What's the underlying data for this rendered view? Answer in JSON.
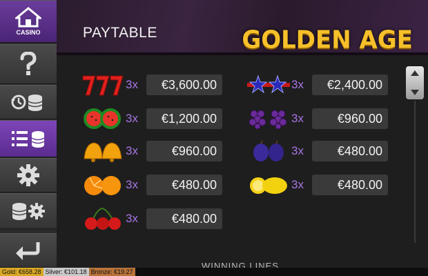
{
  "sidebar": {
    "casino_label": "CASINO",
    "items": [
      {
        "name": "casino",
        "icon": "home-icon"
      },
      {
        "name": "help",
        "icon": "question-icon"
      },
      {
        "name": "history",
        "icon": "history-icon"
      },
      {
        "name": "paytable",
        "icon": "paytable-icon",
        "active": true
      },
      {
        "name": "settings",
        "icon": "gear-icon"
      },
      {
        "name": "bet-settings",
        "icon": "coins-gear-icon"
      },
      {
        "name": "back",
        "icon": "back-arrow-icon"
      }
    ]
  },
  "header": {
    "title": "PAYTABLE",
    "logo_text": "GOLDEN AGE"
  },
  "paytable": {
    "left": [
      {
        "symbol": "sevens",
        "multiplier": "3x",
        "amount": "€3,600.00"
      },
      {
        "symbol": "watermelon",
        "multiplier": "3x",
        "amount": "€1,200.00"
      },
      {
        "symbol": "bells",
        "multiplier": "3x",
        "amount": "€960.00"
      },
      {
        "symbol": "oranges",
        "multiplier": "3x",
        "amount": "€480.00"
      },
      {
        "symbol": "cherries",
        "multiplier": "3x",
        "amount": "€480.00"
      }
    ],
    "right": [
      {
        "symbol": "stars",
        "multiplier": "3x",
        "amount": "€2,400.00"
      },
      {
        "symbol": "grapes",
        "multiplier": "3x",
        "amount": "€960.00"
      },
      {
        "symbol": "plums",
        "multiplier": "3x",
        "amount": "€480.00"
      },
      {
        "symbol": "lemons",
        "multiplier": "3x",
        "amount": "€480.00"
      }
    ]
  },
  "section_next": "WINNING LINES",
  "jackpots": {
    "gold": "Gold: €658.28",
    "silver": "Silver: €101.18",
    "bronze": "Bronze: €19.27"
  },
  "colors": {
    "accent_purple": "#6a3d9a",
    "multiplier": "#a876e6",
    "logo_gold": "#f6c02a"
  }
}
